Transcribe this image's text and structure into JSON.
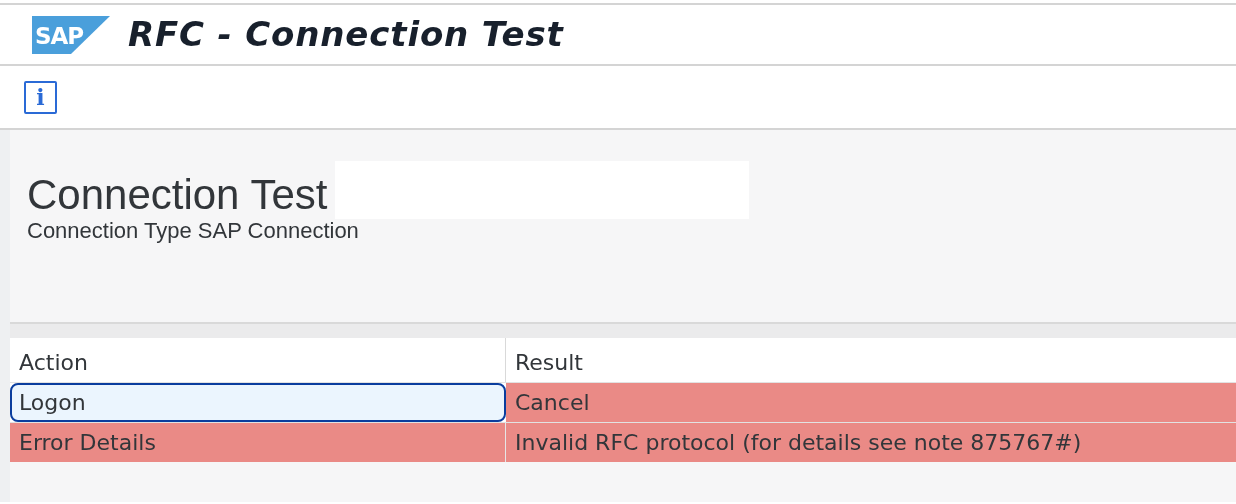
{
  "window": {
    "title": "RFC - Connection Test",
    "logo": "SAP"
  },
  "toolbar": {
    "info_button": "i"
  },
  "heading": {
    "title": "Connection Test",
    "subtitle": "Connection Type SAP Connection"
  },
  "table": {
    "columns": [
      "Action",
      "Result"
    ],
    "rows": [
      {
        "error": true,
        "cells": [
          {
            "text": "Logon",
            "focused": true
          },
          {
            "text": "Cancel",
            "focused": false
          }
        ]
      },
      {
        "error": true,
        "cells": [
          {
            "text": "Error Details",
            "focused": false
          },
          {
            "text": "Invalid RFC protocol (for details see note 875767#)",
            "focused": false
          }
        ]
      }
    ]
  }
}
